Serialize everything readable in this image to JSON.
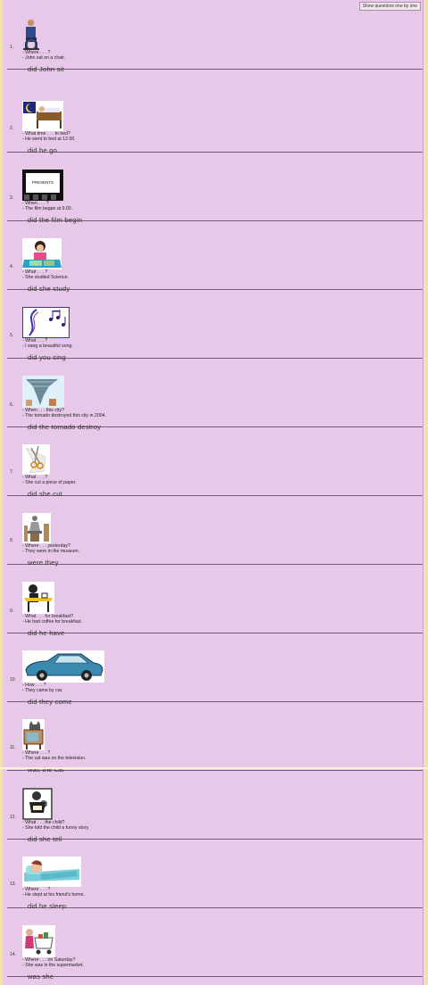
{
  "toolbar": {
    "show_one_label": "Show questions one by one"
  },
  "questions": [
    {
      "num": "1.",
      "icon": "man-sitting-chair-icon",
      "prompt": "- Where . . . ?",
      "answer_line": "- John sat on a chair.",
      "answer": "did John sit"
    },
    {
      "num": "2.",
      "icon": "bed-moon-icon",
      "prompt": "- What time . . . to bed?",
      "answer_line": "- He went to bed at 12.00.",
      "answer": "did he go"
    },
    {
      "num": "3.",
      "icon": "cinema-presents-icon",
      "sign": "PRESENTS",
      "prompt": "- When . . . ?",
      "answer_line": "- The film began at 9.00.",
      "answer": "did the film begin"
    },
    {
      "num": "4.",
      "icon": "girl-studying-icon",
      "prompt": "- What . . . ?",
      "answer_line": "- She studied Science.",
      "answer": "did she study"
    },
    {
      "num": "5.",
      "icon": "music-notes-icon",
      "prompt": "- What . . . ?",
      "answer_line": "- I sang a beautiful song.",
      "answer": "did you sing"
    },
    {
      "num": "6.",
      "icon": "tornado-icon",
      "prompt": "- When . . . this city?",
      "answer_line": "- The tornado destroyed this city in 2004.",
      "answer": "did the tornado destroy"
    },
    {
      "num": "7.",
      "icon": "scissors-paper-icon",
      "prompt": "- What . . . ?",
      "answer_line": "- She cut a piece of paper.",
      "answer": "did she cut"
    },
    {
      "num": "8.",
      "icon": "museum-statue-icon",
      "prompt": "- Where . . . yesterday?",
      "answer_line": "- They were in the museum.",
      "answer": "were they"
    },
    {
      "num": "9.",
      "icon": "breakfast-table-icon",
      "prompt": "- What . . . for breakfast?",
      "answer_line": "- He had coffee for breakfast.",
      "answer": "did he have"
    },
    {
      "num": "10.",
      "icon": "blue-car-icon",
      "prompt": "- How . . . ?",
      "answer_line": "- They came by car.",
      "answer": "did they come"
    },
    {
      "num": "11.",
      "icon": "cat-on-television-icon",
      "prompt": "- Where . . . ?",
      "answer_line": "- The cat was on the television.",
      "answer": "was the cat"
    },
    {
      "num": "12.",
      "icon": "reading-story-icon",
      "prompt": "- What . . . the child?",
      "answer_line": "- She told the child a funny story.",
      "answer": "did she tell"
    },
    {
      "num": "13.",
      "icon": "sleeping-person-icon",
      "prompt": "- Where . . . ?",
      "answer_line": "- He slept at his friend's home.",
      "answer": "did he sleep"
    },
    {
      "num": "14.",
      "icon": "shopping-cart-icon",
      "prompt": "- Where . . . on Saturday?",
      "answer_line": "- She was in the supermarket.",
      "answer": "was she"
    }
  ]
}
